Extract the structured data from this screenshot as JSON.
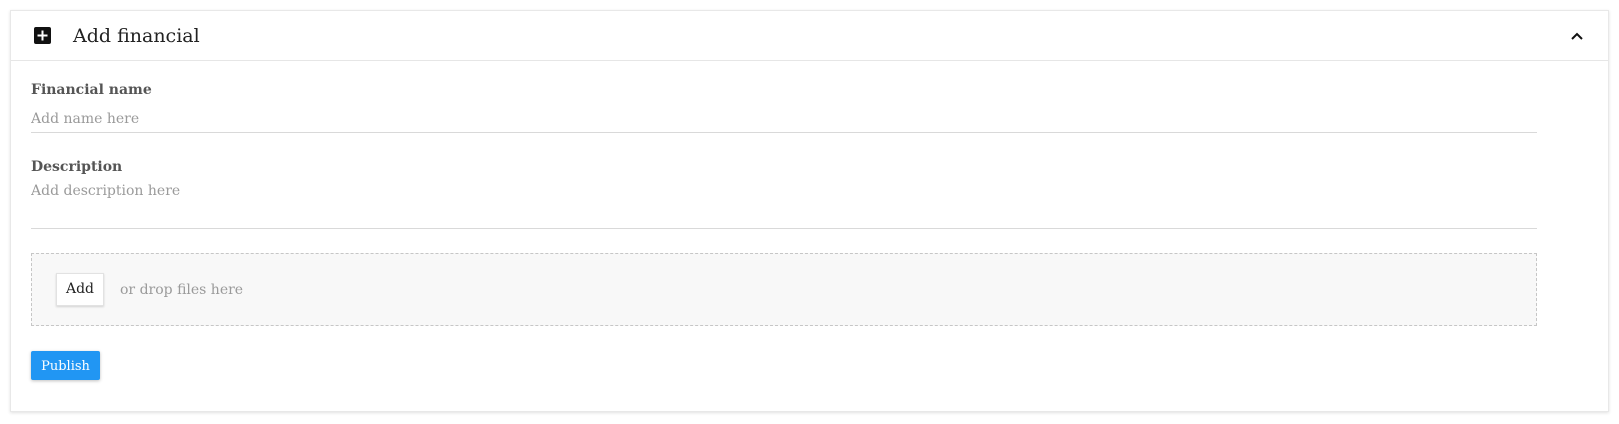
{
  "panel": {
    "title": "Add financial",
    "header_icon": "plus-square-icon",
    "toggle_icon": "chevron-up-icon"
  },
  "form": {
    "name_label": "Financial name",
    "name_placeholder": "Add name here",
    "name_value": "",
    "description_label": "Description",
    "description_placeholder": "Add description here",
    "description_value": ""
  },
  "upload": {
    "add_label": "Add",
    "drop_text": "or drop files here"
  },
  "actions": {
    "publish_label": "Publish"
  },
  "colors": {
    "accent": "#2196f3",
    "icon": "#111111",
    "dropzone_bg": "#f8f8f8"
  }
}
